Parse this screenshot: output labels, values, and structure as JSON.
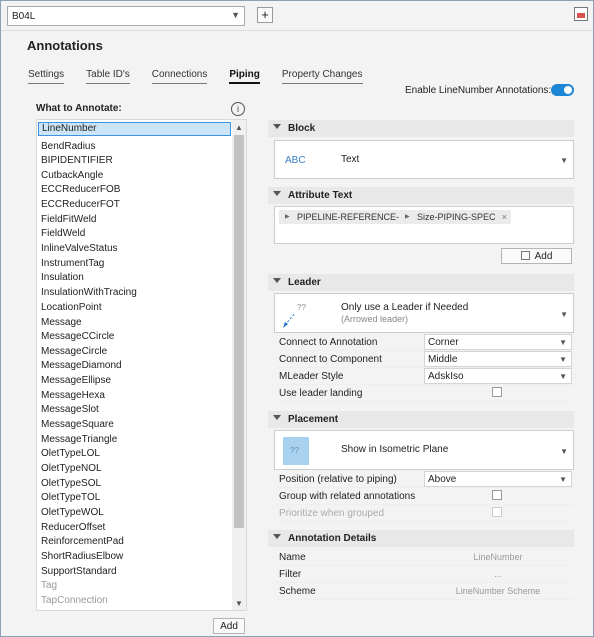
{
  "header": {
    "drawing_combo_value": "B04L",
    "add_button_label": "+",
    "title": "Annotations"
  },
  "tabs": [
    {
      "label": "Settings",
      "active": false
    },
    {
      "label": "Table ID's",
      "active": false
    },
    {
      "label": "Connections",
      "active": false
    },
    {
      "label": "Piping",
      "active": true
    },
    {
      "label": "Property Changes",
      "active": false
    }
  ],
  "enable_toggle": {
    "label": "Enable LineNumber Annotations:",
    "on": true
  },
  "what_to_annotate": {
    "label": "What to Annotate:",
    "info_glyph": "i",
    "selected": "LineNumber",
    "items": [
      "LineNumber",
      "BendRadius",
      "BIPIDENTIFIER",
      "CutbackAngle",
      "ECCReducerFOB",
      "ECCReducerFOT",
      "FieldFitWeld",
      "FieldWeld",
      "InlineValveStatus",
      "InstrumentTag",
      "Insulation",
      "InsulationWithTracing",
      "LocationPoint",
      "Message",
      "MessageCCircle",
      "MessageCircle",
      "MessageDiamond",
      "MessageEllipse",
      "MessageHexa",
      "MessageSlot",
      "MessageSquare",
      "MessageTriangle",
      "OletTypeLOL",
      "OletTypeNOL",
      "OletTypeSOL",
      "OletTypeTOL",
      "OletTypeWOL",
      "ReducerOffset",
      "ReinforcementPad",
      "ShortRadiusElbow",
      "SupportStandard",
      "Tag",
      "TapConnection"
    ],
    "dim_items": [
      "Tag",
      "TapConnection"
    ],
    "add_button": "Add"
  },
  "block": {
    "section_label": "Block",
    "icon_text": "ABC",
    "value": "Text"
  },
  "attribute_text": {
    "section_label": "Attribute Text",
    "tokens": [
      "PIPELINE-REFERENCE-",
      "Size-PIPING-SPEC"
    ],
    "token_close_glyph": "×",
    "add_button": "Add"
  },
  "leader": {
    "section_label": "Leader",
    "choice_title": "Only use a Leader if Needed",
    "choice_subtitle": "(Arrowed leader)",
    "icon_text": "??",
    "rows": [
      {
        "label": "Connect to Annotation",
        "value": "Corner"
      },
      {
        "label": "Connect to Component",
        "value": "Middle"
      },
      {
        "label": "MLeader Style",
        "value": "AdskIso"
      },
      {
        "label": "Use leader landing",
        "checked": false
      }
    ]
  },
  "placement": {
    "section_label": "Placement",
    "choice_title": "Show in Isometric Plane",
    "icon_text": "??",
    "rows": [
      {
        "label": "Position (relative to piping)",
        "value": "Above"
      },
      {
        "label": "Group with related annotations",
        "checked": false
      },
      {
        "label": "Prioritize when grouped",
        "checked": false
      }
    ]
  },
  "details": {
    "section_label": "Annotation Details",
    "rows": [
      {
        "label": "Name",
        "value": "LineNumber"
      },
      {
        "label": "Filter",
        "value": "..."
      },
      {
        "label": "Scheme",
        "value": "LineNumber Scheme"
      }
    ]
  },
  "colors": {
    "accent": "#1e86d6",
    "selection": "#cce4f7",
    "selection_border": "#3c94e0",
    "section_header": "#e8e8e8"
  }
}
